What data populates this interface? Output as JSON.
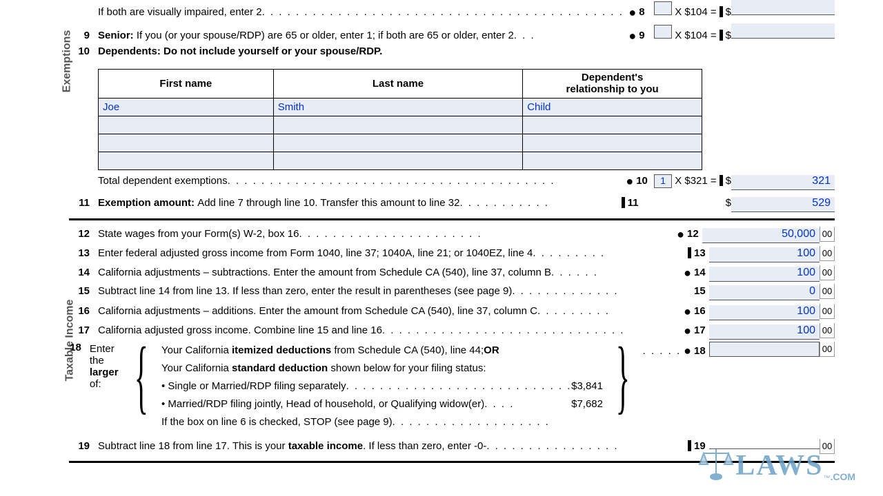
{
  "section_labels": {
    "exemptions": "Exemptions",
    "taxable": "Taxable Income"
  },
  "line8": {
    "text_fragment": "If both are visually impaired, enter 2",
    "num_right": "8",
    "calc": "X  $104 =",
    "amount": ""
  },
  "line9": {
    "num": "9",
    "label": "Senior:",
    "text": "If you (or your spouse/RDP) are 65 or older, enter 1; if both are 65 or older, enter 2",
    "num_right": "9",
    "calc": "X  $104 =",
    "amount": ""
  },
  "line10": {
    "num": "10",
    "label": "Dependents:",
    "text": "Do not include yourself or your spouse/RDP.",
    "headers": [
      "First name",
      "Last name",
      "Dependent's\nrelationship to you"
    ],
    "rows": [
      {
        "first": "Joe",
        "last": "Smith",
        "rel": "Child"
      },
      {
        "first": "",
        "last": "",
        "rel": ""
      },
      {
        "first": "",
        "last": "",
        "rel": ""
      },
      {
        "first": "",
        "last": "",
        "rel": ""
      }
    ],
    "total_text": "Total dependent exemptions",
    "num_right": "10",
    "count": "1",
    "calc": "X  $321 =",
    "amount": "321"
  },
  "line11": {
    "num": "11",
    "label": "Exemption amount:",
    "text": "Add line 7 through line 10. Transfer this amount to line 32",
    "num_right": "11",
    "amount": "529"
  },
  "line12": {
    "num": "12",
    "text": "State wages from your Form(s) W-2, box 16",
    "num_right": "12",
    "amount": "50,000",
    "cents": "00"
  },
  "line13": {
    "num": "13",
    "text": "Enter federal adjusted gross income from Form 1040, line 37; 1040A, line 21; or 1040EZ, line 4",
    "num_right": "13",
    "amount": "100",
    "cents": "00"
  },
  "line14": {
    "num": "14",
    "text": "California adjustments – subtractions. Enter the amount from Schedule CA (540), line 37, column B",
    "num_right": "14",
    "amount": "100",
    "cents": "00"
  },
  "line15": {
    "num": "15",
    "text": "Subtract line 14 from line 13. If less than zero, enter the result in parentheses (see page 9)",
    "num_right": "15",
    "amount": "0",
    "cents": "00"
  },
  "line16": {
    "num": "16",
    "text": "California adjustments – additions. Enter the amount from Schedule CA (540), line 37, column C",
    "num_right": "16",
    "amount": "100",
    "cents": "00"
  },
  "line17": {
    "num": "17",
    "text": "California adjusted gross income. Combine line 15 and line 16",
    "num_right": "17",
    "amount": "100",
    "cents": "00"
  },
  "line18": {
    "num": "18",
    "intro1": "Enter the",
    "intro2": "larger",
    "intro3": " of:",
    "r1a": "Your California ",
    "r1b": "itemized deductions",
    "r1c": " from Schedule CA (540), line 44; ",
    "r1d": "OR",
    "r2a": "Your California ",
    "r2b": "standard deduction",
    "r2c": " shown below for your filing status:",
    "r3": "• Single or Married/RDP filing separately",
    "r3amt": "$3,841",
    "r4": "• Married/RDP filing jointly, Head of household, or Qualifying widow(er)",
    "r4amt": "$7,682",
    "r5": "If the box on line 6 is checked, STOP (see page 9)",
    "num_right": "18",
    "cents": "00"
  },
  "line19": {
    "num": "19",
    "t1": "Subtract line 18 from line 17. This is your ",
    "t2": "taxable income",
    "t3": ". If less than zero, enter -0-",
    "num_right": "19",
    "cents": "00"
  },
  "watermark": {
    "text": "LAWS",
    "suffix": ".COM",
    "tm": "™"
  },
  "dollar_sign": "$"
}
